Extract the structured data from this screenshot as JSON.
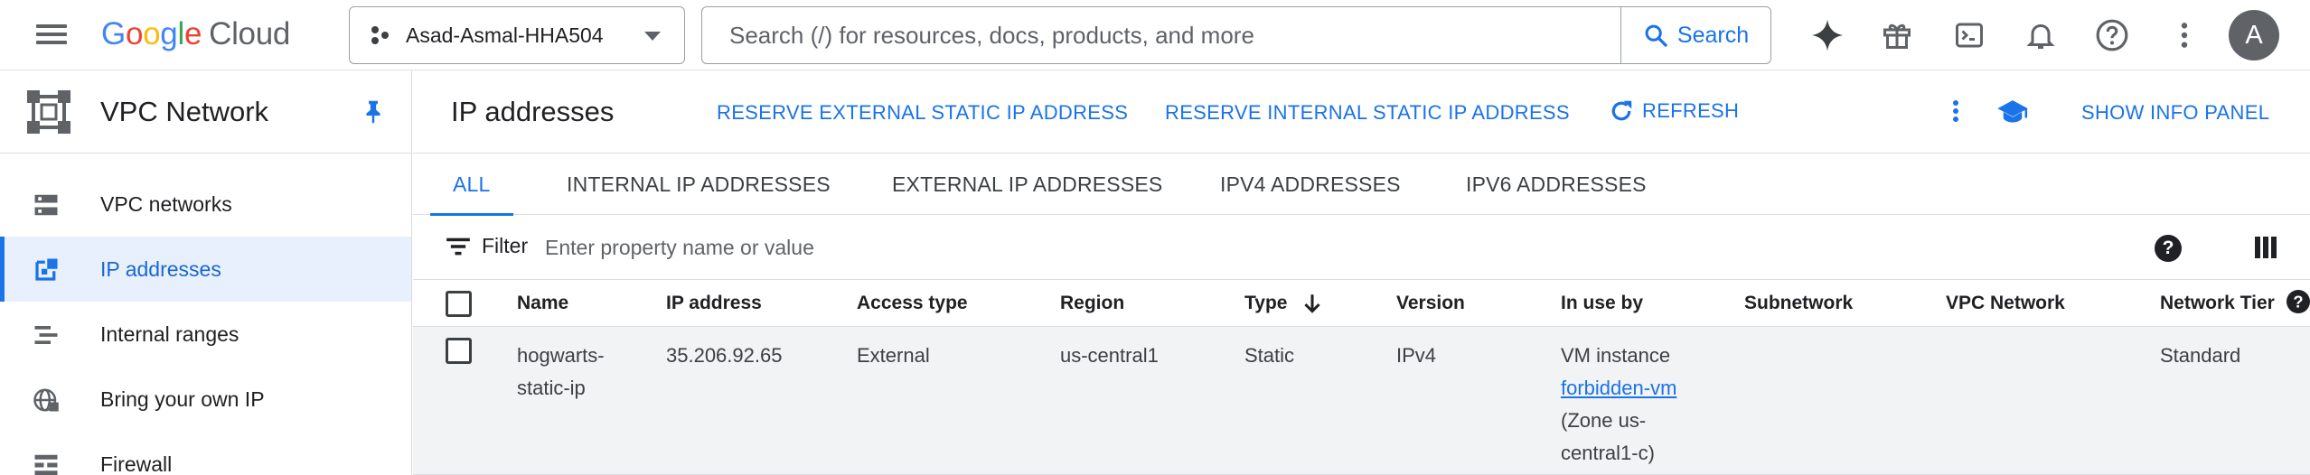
{
  "header": {
    "logo_google": "Google",
    "logo_cloud": "Cloud",
    "project_name": "Asad-Asmal-HHA504",
    "search_placeholder": "Search (/) for resources, docs, products, and more",
    "search_button": "Search",
    "avatar_letter": "A",
    "icons": [
      "menu-icon",
      "gemini-spark-icon",
      "gift-icon",
      "cloud-shell-icon",
      "notifications-icon",
      "help-icon",
      "more-vert-icon"
    ]
  },
  "sidebar": {
    "product_title": "VPC Network",
    "items": [
      {
        "label": "VPC networks",
        "icon": "vpc-networks-icon",
        "active": false
      },
      {
        "label": "IP addresses",
        "icon": "ip-addresses-icon",
        "active": true
      },
      {
        "label": "Internal ranges",
        "icon": "internal-ranges-icon",
        "active": false
      },
      {
        "label": "Bring your own IP",
        "icon": "globe-icon",
        "active": false
      },
      {
        "label": "Firewall",
        "icon": "firewall-icon",
        "active": false
      }
    ]
  },
  "main": {
    "title": "IP addresses",
    "actions": {
      "reserve_external": "RESERVE EXTERNAL STATIC IP ADDRESS",
      "reserve_internal": "RESERVE INTERNAL STATIC IP ADDRESS",
      "refresh": "REFRESH",
      "show_info_panel": "SHOW INFO PANEL"
    },
    "tabs": [
      "ALL",
      "INTERNAL IP ADDRESSES",
      "EXTERNAL IP ADDRESSES",
      "IPV4 ADDRESSES",
      "IPV6 ADDRESSES"
    ],
    "active_tab": "ALL",
    "filter": {
      "label": "Filter",
      "placeholder": "Enter property name or value"
    },
    "table": {
      "columns": [
        "Name",
        "IP address",
        "Access type",
        "Region",
        "Type",
        "Version",
        "In use by",
        "Subnetwork",
        "VPC Network",
        "Network Tier"
      ],
      "sorted_column": "Type",
      "sort_direction": "descending",
      "rows": [
        {
          "name_line1": "hogwarts-",
          "name_line2": "static-ip",
          "ip_address": "35.206.92.65",
          "access_type": "External",
          "region": "us-central1",
          "type": "Static",
          "version": "IPv4",
          "in_use_by_prefix": "VM instance",
          "in_use_by_link": "forbidden-vm",
          "in_use_by_zone_line1": "(Zone us-",
          "in_use_by_zone_line2": "central1-c)",
          "subnetwork": "",
          "vpc_network": "",
          "network_tier": "Standard"
        }
      ]
    }
  },
  "colors": {
    "accent": "#1a73e8",
    "active_nav_bg": "#e8f0fe",
    "row_bg": "#f1f3f4",
    "border": "#dadce0"
  }
}
